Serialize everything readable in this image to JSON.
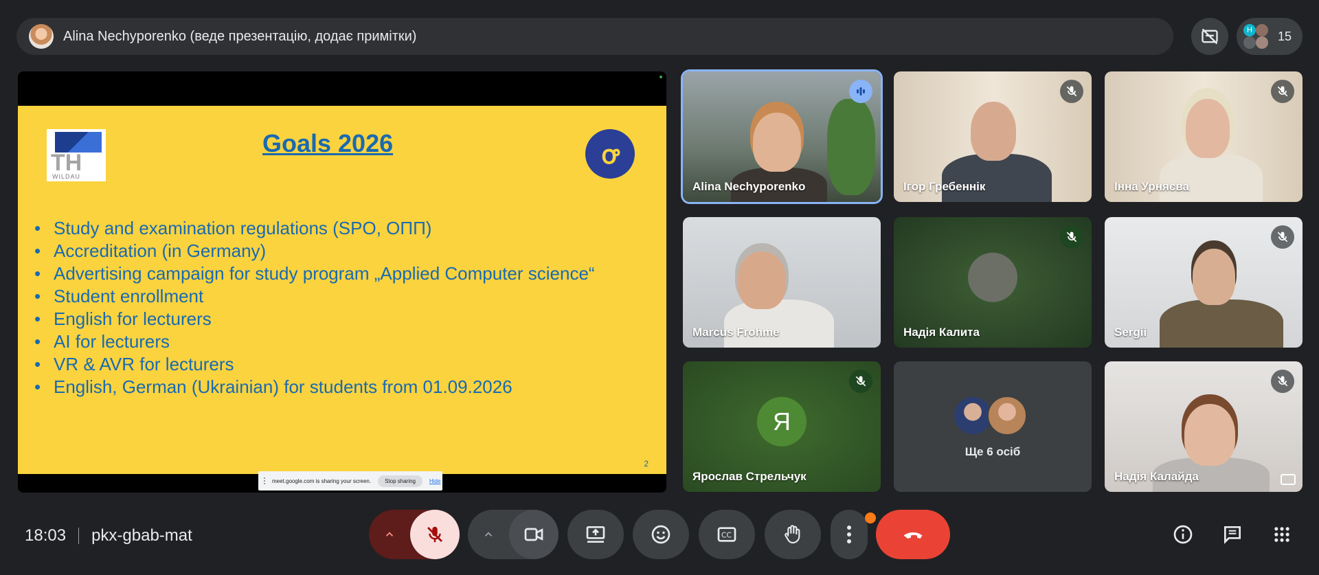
{
  "presenter_bar": {
    "label": "Alina Nechyporenko (веде презентацію, додає примітки)"
  },
  "people": {
    "count": "15",
    "mini_avatar_letter": "H"
  },
  "slide": {
    "title": "Goals 2026",
    "logo_left_text": "TH",
    "logo_left_subtext": "WILDAU",
    "goals": [
      "Study and examination regulations (SPO, ОПП)",
      "Accreditation (in Germany)",
      "Advertising campaign for study program „Applied Computer science“",
      "Student enrollment",
      "English for lecturers",
      "AI for lecturers",
      "VR & AVR for lecturers",
      "English, German (Ukrainian) for students from 01.09.2026"
    ],
    "page_number": "2",
    "share_notice": "meet.google.com is sharing your screen.",
    "stop_sharing": "Stop sharing",
    "hide": "Hide"
  },
  "tiles": [
    {
      "name": "Alina Nechyporenko",
      "state": "speaking"
    },
    {
      "name": "Ігор Гребеннік",
      "state": "muted"
    },
    {
      "name": "Інна Урняєва",
      "state": "muted"
    },
    {
      "name": "Marcus Frohme",
      "state": "unmuted"
    },
    {
      "name": "Надія Калита",
      "state": "muted"
    },
    {
      "name": "Sergii",
      "state": "muted"
    },
    {
      "name": "Ярослав Стрельчук",
      "state": "muted",
      "initial": "Я"
    },
    {
      "name": "Ще 6 осіб",
      "state": "group"
    },
    {
      "name": "Надія Калайда",
      "state": "muted"
    }
  ],
  "footer": {
    "time": "18:03",
    "meeting_code": "pkx-gbab-mat"
  },
  "colors": {
    "background": "#202124",
    "slide_yellow": "#fad33e",
    "slide_blue": "#1a6ab0",
    "mic_off_red": "#f9dedc",
    "end_call_red": "#ea4335",
    "accent_blue": "#8ab4f8"
  }
}
